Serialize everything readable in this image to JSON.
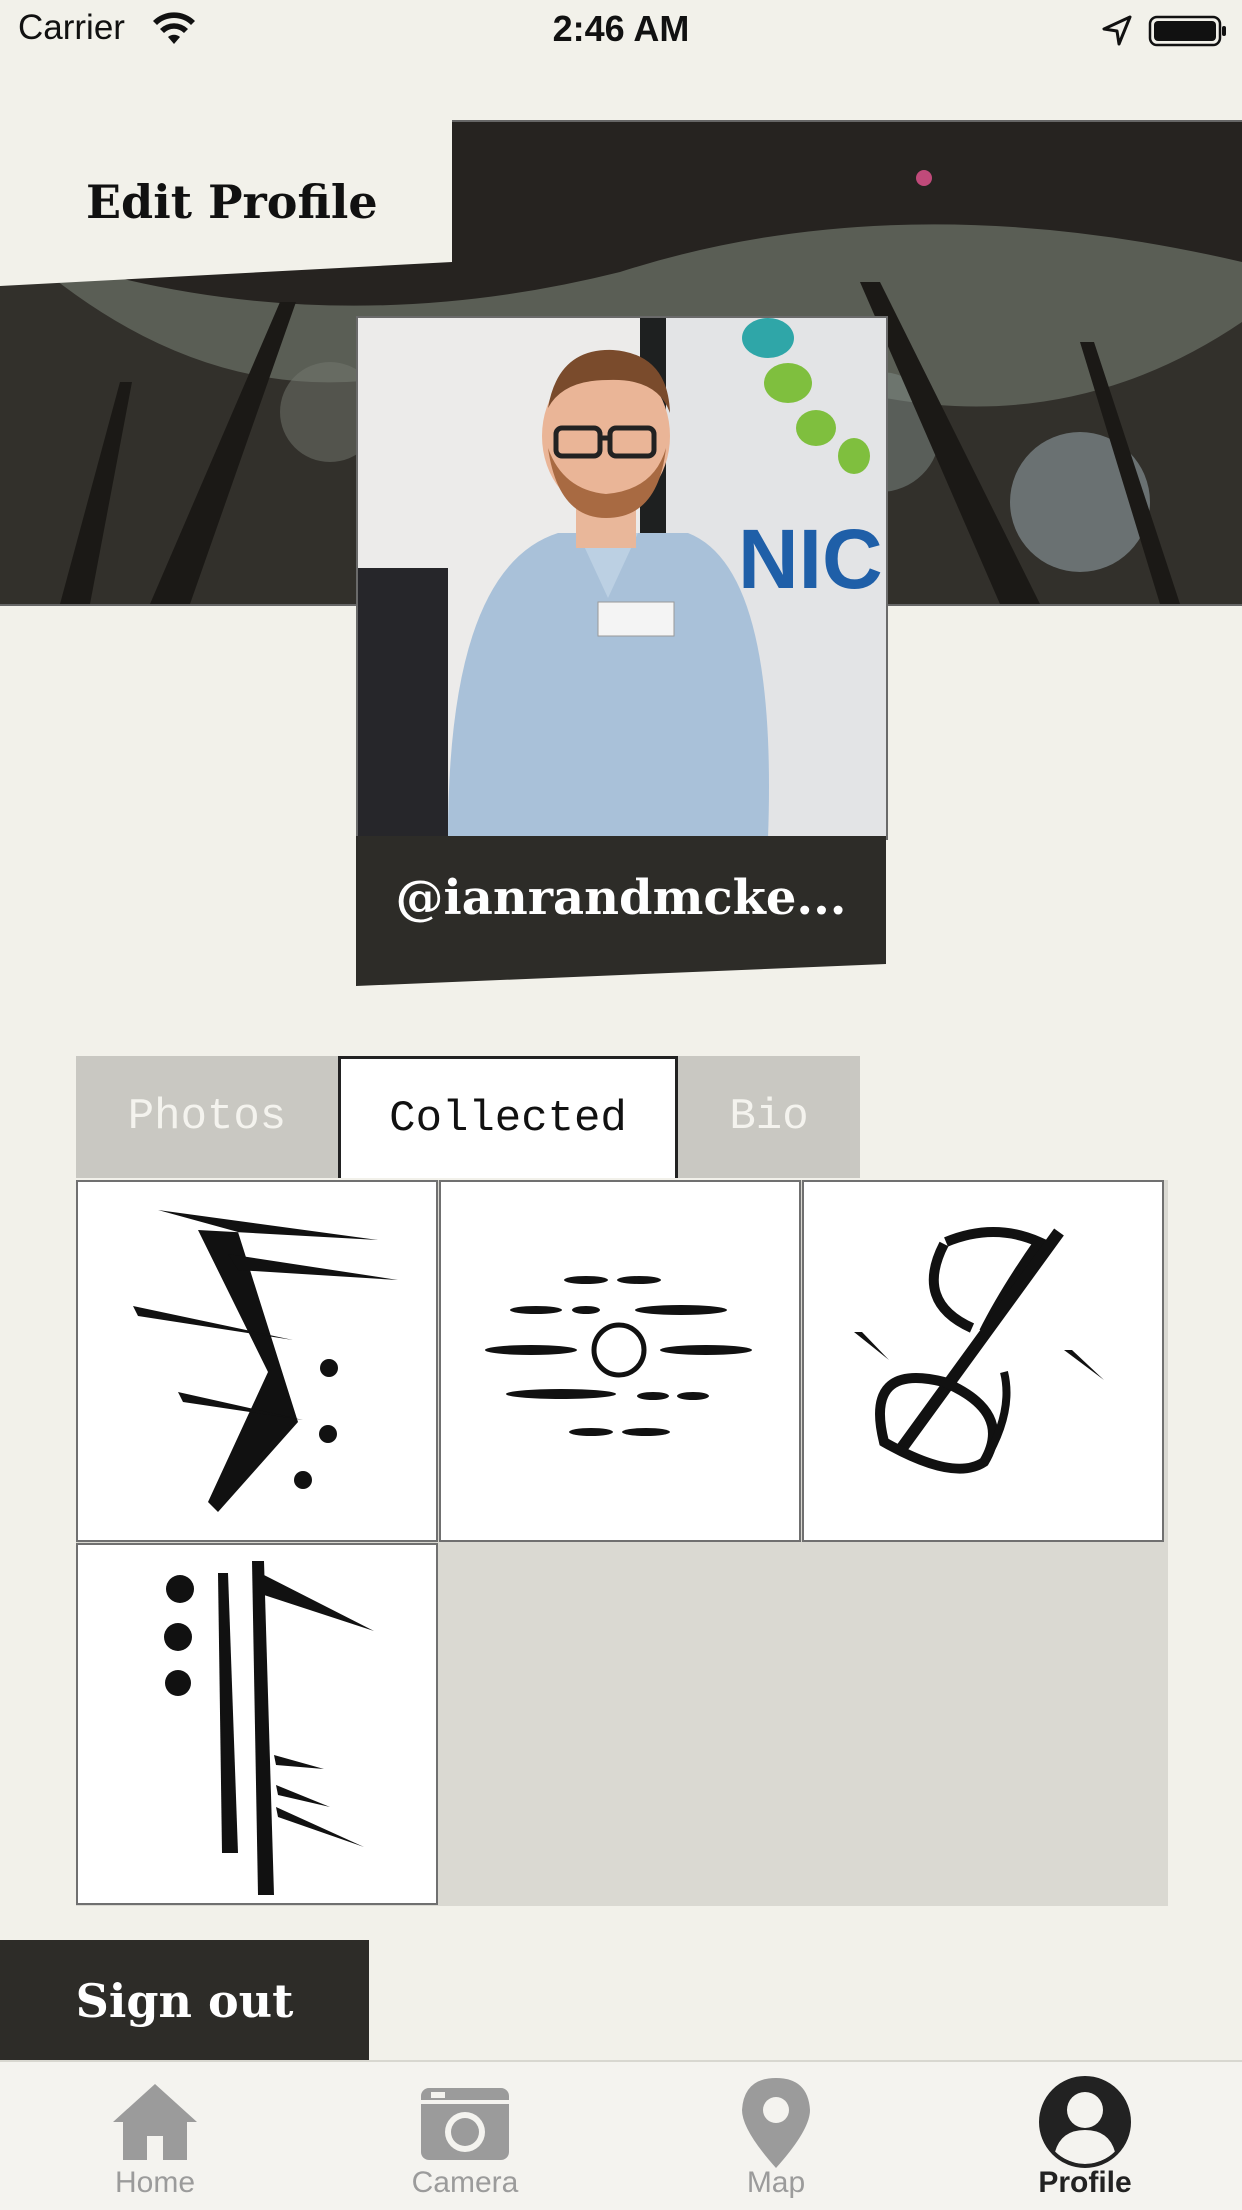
{
  "status_bar": {
    "carrier": "Carrier",
    "time": "2:46 AM"
  },
  "header": {
    "title": "Edit Profile"
  },
  "profile": {
    "handle": "@ianrandmcke..."
  },
  "tabs": [
    {
      "label": "Photos",
      "selected": false
    },
    {
      "label": "Collected",
      "selected": true
    },
    {
      "label": "Bio",
      "selected": false
    }
  ],
  "collected_items_count": 4,
  "actions": {
    "sign_out_label": "Sign out"
  },
  "tab_bar": {
    "items": [
      {
        "label": "Home",
        "icon": "home-icon",
        "active": false
      },
      {
        "label": "Camera",
        "icon": "camera-icon",
        "active": false
      },
      {
        "label": "Map",
        "icon": "map-pin-icon",
        "active": false
      },
      {
        "label": "Profile",
        "icon": "profile-icon",
        "active": true
      }
    ]
  },
  "colors": {
    "background": "#f2f1ea",
    "dark": "#2d2c28",
    "inactive_tab": "#c9c8c2",
    "inactive_icon": "#9b9b9b"
  }
}
